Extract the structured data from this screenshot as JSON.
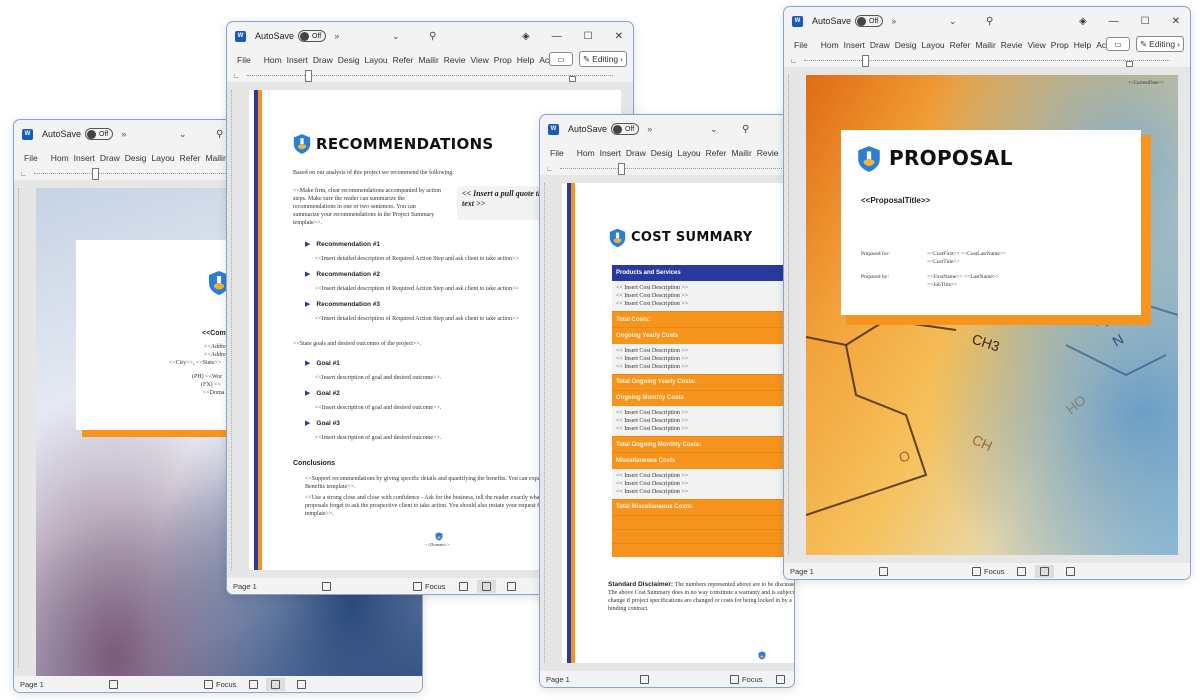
{
  "app": {
    "autosave_label": "AutoSave",
    "autosave_state": "Off",
    "overflow_glyph": "»",
    "ribbon_tabs": [
      "File",
      "Hom",
      "Insert",
      "Draw",
      "Desig",
      "Layou",
      "Refer",
      "Mailir",
      "Revie",
      "View",
      "Prop",
      "Help",
      "Acrol"
    ],
    "editing_label": "Editing",
    "status_page": "Page 1",
    "focus_label": "Focus",
    "accent_orange": "#f7941d",
    "accent_navy": "#2a3a9c"
  },
  "windows": {
    "cover_page": {
      "company_lines": [
        "<<Compa",
        "<<Addre",
        "<<Addre",
        "<<City>>, <<State>>",
        "(PH) <<Wor",
        "(FX) <<",
        "<<Doma"
      ]
    },
    "recommendations": {
      "title": "RECOMMENDATIONS",
      "intro": "Based on our analysis of this project we recommend the following:",
      "body": "<<Make firm, clear recommendations accompanied by action steps.  Make sure the reader can summarize the recommendations in one or two sentences.  You can summarize your recommendations in the Project Summary template>>.",
      "pull_quote": "<< Insert a pull quote that will be in emphasis text >>",
      "recommendations": [
        {
          "heading": "Recommendation #1",
          "text": "<<Insert detailed description of Required Action Step and ask client to take action>>"
        },
        {
          "heading": "Recommendation #2",
          "text": "<<Insert detailed description of Required Action Step and ask client to take action>>"
        },
        {
          "heading": "Recommendation #3",
          "text": "<<Insert detailed description of Required Action Step and ask client to take action>>"
        }
      ],
      "goals_intro": "<<State goals and desired outcomes of the project>>.",
      "goals": [
        {
          "heading": "Goal #1",
          "text": "<<Insert description of goal and desired outcome>>."
        },
        {
          "heading": "Goal #2",
          "text": "<<Insert description of goal and desired outcome>>."
        },
        {
          "heading": "Goal #3",
          "text": "<<Insert description of goal and desired outcome>>."
        }
      ],
      "conclusions_heading": "Conclusions",
      "conclusions": [
        "<<Support recommendations by giving specific details and quantifying the benefits.  You can expand on the benefits by adding the Benefits template>>.",
        "<<Use a strong close and close with confidence - Ask for the business, tell the reader exactly what you want him or her to do.  Many proposals forget to ask the prospective client to take action. You should also restate your request for action in the Project Summary template>>."
      ],
      "footer_domain": "<<Domain>>"
    },
    "cost_summary": {
      "title": "COST SUMMARY",
      "table_header": "Products and Services",
      "insert_line": "<< Insert Cost Description >>",
      "rows": {
        "total_costs": "Total Costs:",
        "yearly": "Ongoing Yearly Costs",
        "total_yearly": "Total Ongoing Yearly Costs:",
        "monthly": "Ongoing Monthly Costs",
        "total_monthly": "Total Ongoing Monthly Costs:",
        "misc": "Miscellaneous Costs",
        "total_misc": "Total Miscellaneous Costs:"
      },
      "disclaimer_label": "Standard Disclaimer:",
      "disclaimer_text": "The numbers represented above are to be discussed. The above Cost Summary does in no way constitute a warranty and is subject to change if project specifications are changed or costs for being locked in by a binding contract.",
      "footer_domain": "<<Domain>>"
    },
    "proposal": {
      "current_date": "<<CurrentDate>>",
      "title": "PROPOSAL",
      "proposal_title": "<<ProposalTitle>>",
      "prepared_for_label": "Prepared for:",
      "prepared_for_line1": "<<CustFirst>> <<CustLastName>>",
      "prepared_for_line2": "<<CustTitle>>",
      "prepared_by_label": "Prepared by:",
      "prepared_by_line1": "<<FirstName>> <<LastName>>",
      "prepared_by_line2": "<<JobTitle>>",
      "molecule_labels": [
        "CH3",
        "H",
        "N",
        "HO",
        "O",
        "CH"
      ]
    }
  }
}
